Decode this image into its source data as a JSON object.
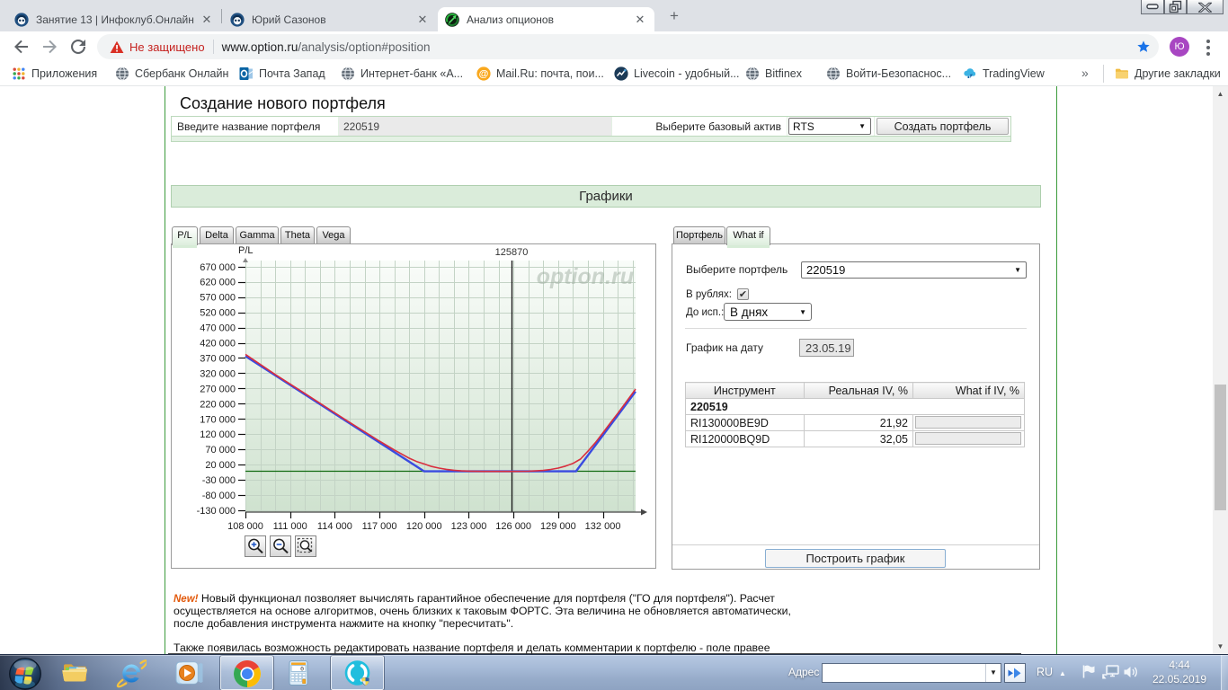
{
  "browser": {
    "tabs": [
      {
        "title": "Занятие 13 | Инфоклуб.Онлайн",
        "favicon": "infoclub-icon"
      },
      {
        "title": "Юрий Сазонов",
        "favicon": "infoclub-icon"
      },
      {
        "title": "Анализ опционов",
        "favicon": "option-ru-icon"
      }
    ],
    "window_controls": {
      "close_glyph": "✕"
    },
    "address": {
      "security_text": "Не защищено",
      "url_host": "www.option.ru",
      "url_path": "/analysis/option#position",
      "profile_initial": "Ю"
    },
    "bookmarks": {
      "items": [
        {
          "label": "Приложения",
          "icon": "apps-grid-icon"
        },
        {
          "label": "Сбербанк Онлайн",
          "icon": "globe-icon"
        },
        {
          "label": "Почта Запад",
          "icon": "outlook-icon"
        },
        {
          "label": "Интернет-банк «А...",
          "icon": "globe-icon"
        },
        {
          "label": "Mail.Ru: почта, пои...",
          "icon": "mailru-icon"
        },
        {
          "label": "Livecoin - удобный...",
          "icon": "livecoin-icon"
        },
        {
          "label": "Bitfinex",
          "icon": "globe-icon"
        },
        {
          "label": "Войти-Безопаснос...",
          "icon": "globe-icon"
        },
        {
          "label": "TradingView",
          "icon": "tradingview-icon"
        }
      ],
      "overflow_glyph": "»",
      "other_label": "Другие закладки"
    }
  },
  "page": {
    "heading": "Создание нового портфеля",
    "portfolio_form": {
      "name_label": "Введите название портфеля",
      "name_value": "220519",
      "asset_label": "Выберите базовый актив",
      "asset_value": "RTS",
      "create_button": "Создать портфель"
    },
    "charts_header": "Графики",
    "chart_tabs": [
      "P/L",
      "Delta",
      "Gamma",
      "Theta",
      "Vega"
    ],
    "right_tabs": [
      "Портфель",
      "What if"
    ],
    "whatif": {
      "select_portfolio_label": "Выберите портфель",
      "portfolio_value": "220519",
      "rubles_label": "В рублях:",
      "rubles_checked": "✔",
      "until_exp_label": "До исп.:",
      "until_exp_value": "В днях",
      "date_label": "График на дату",
      "date_value": "23.05.19",
      "table": {
        "headers": [
          "Инструмент",
          "Реальная IV, %",
          "What if IV, %"
        ],
        "group_row": "220519",
        "rows": [
          {
            "instrument": "RI130000BE9D",
            "real_iv": "21,92",
            "whatif_iv": ""
          },
          {
            "instrument": "RI120000BQ9D",
            "real_iv": "32,05",
            "whatif_iv": ""
          }
        ]
      },
      "build_button": "Построить график"
    },
    "notes": {
      "new_badge": "New!",
      "line1": "Новый функционал позволяет вычислять гарантийное обеспечение для портфеля (\"ГО для портфеля\"). Расчет",
      "line2": "осуществляется на основе алгоритмов, очень близких к таковым ФОРТС. Эта величина не обновляется автоматически,",
      "line3": "после добавления инструмента нажмите на кнопку \"пересчитать\".",
      "line4": "Также появилась возможность редактировать название портфеля и делать комментарии к портфелю - поле правее"
    }
  },
  "chart_data": {
    "type": "line",
    "ylabel": "P/L",
    "watermark": "option.ru",
    "xlim": [
      108000,
      134200
    ],
    "ylim": [
      -136000,
      690000
    ],
    "x_ticks": [
      108000,
      111000,
      114000,
      117000,
      120000,
      123000,
      126000,
      129000,
      132000
    ],
    "x_tick_labels": [
      "108 000",
      "111 000",
      "114 000",
      "117 000",
      "120 000",
      "123 000",
      "126 000",
      "129 000",
      "132 000"
    ],
    "y_ticks": [
      670000,
      620000,
      570000,
      520000,
      470000,
      420000,
      370000,
      320000,
      270000,
      220000,
      170000,
      120000,
      70000,
      20000,
      -30000,
      -80000,
      -130000
    ],
    "y_tick_labels": [
      "670 000",
      "620 000",
      "570 000",
      "520 000",
      "470 000",
      "420 000",
      "370 000",
      "320 000",
      "270 000",
      "220 000",
      "170 000",
      "120 000",
      "70 000",
      "20 000",
      "-30 000",
      "-80 000",
      "-130 000"
    ],
    "grid_x_step": 1000,
    "price_line": {
      "x": 125870,
      "label": "125870"
    },
    "zero_line": 0,
    "grid": true,
    "legend": false,
    "series": [
      {
        "name": "expiration",
        "color": "#3a4be0",
        "width": 2.4,
        "points": [
          [
            108000,
            376000
          ],
          [
            120000,
            -2000
          ],
          [
            130200,
            -2000
          ],
          [
            134200,
            260000
          ]
        ]
      },
      {
        "name": "current",
        "color": "#d92f3e",
        "width": 1.6,
        "points": [
          [
            108000,
            382000
          ],
          [
            110000,
            316000
          ],
          [
            112000,
            253000
          ],
          [
            114000,
            190000
          ],
          [
            115000,
            158500
          ],
          [
            116000,
            128000
          ],
          [
            117000,
            97000
          ],
          [
            118000,
            68000
          ],
          [
            119000,
            41000
          ],
          [
            119500,
            30000
          ],
          [
            120000,
            22000
          ],
          [
            120500,
            14000
          ],
          [
            121000,
            8500
          ],
          [
            121500,
            4500
          ],
          [
            122000,
            1500
          ],
          [
            122500,
            -500
          ],
          [
            123000,
            -1500
          ],
          [
            124000,
            -2300
          ],
          [
            125000,
            -2500
          ],
          [
            126000,
            -2500
          ],
          [
            127000,
            -1800
          ],
          [
            127500,
            -700
          ],
          [
            128000,
            1000
          ],
          [
            128500,
            4000
          ],
          [
            129000,
            8500
          ],
          [
            129500,
            15000
          ],
          [
            130000,
            24000
          ],
          [
            130500,
            38000
          ],
          [
            131000,
            64000
          ],
          [
            131500,
            92000
          ],
          [
            132000,
            124000
          ],
          [
            132500,
            156000
          ],
          [
            133000,
            188000
          ],
          [
            133500,
            221000
          ],
          [
            134200,
            268000
          ]
        ]
      }
    ]
  },
  "taskbar": {
    "address_label": "Адрес",
    "language": "RU",
    "clock_time": "4:44",
    "clock_date": "22.05.2019"
  }
}
